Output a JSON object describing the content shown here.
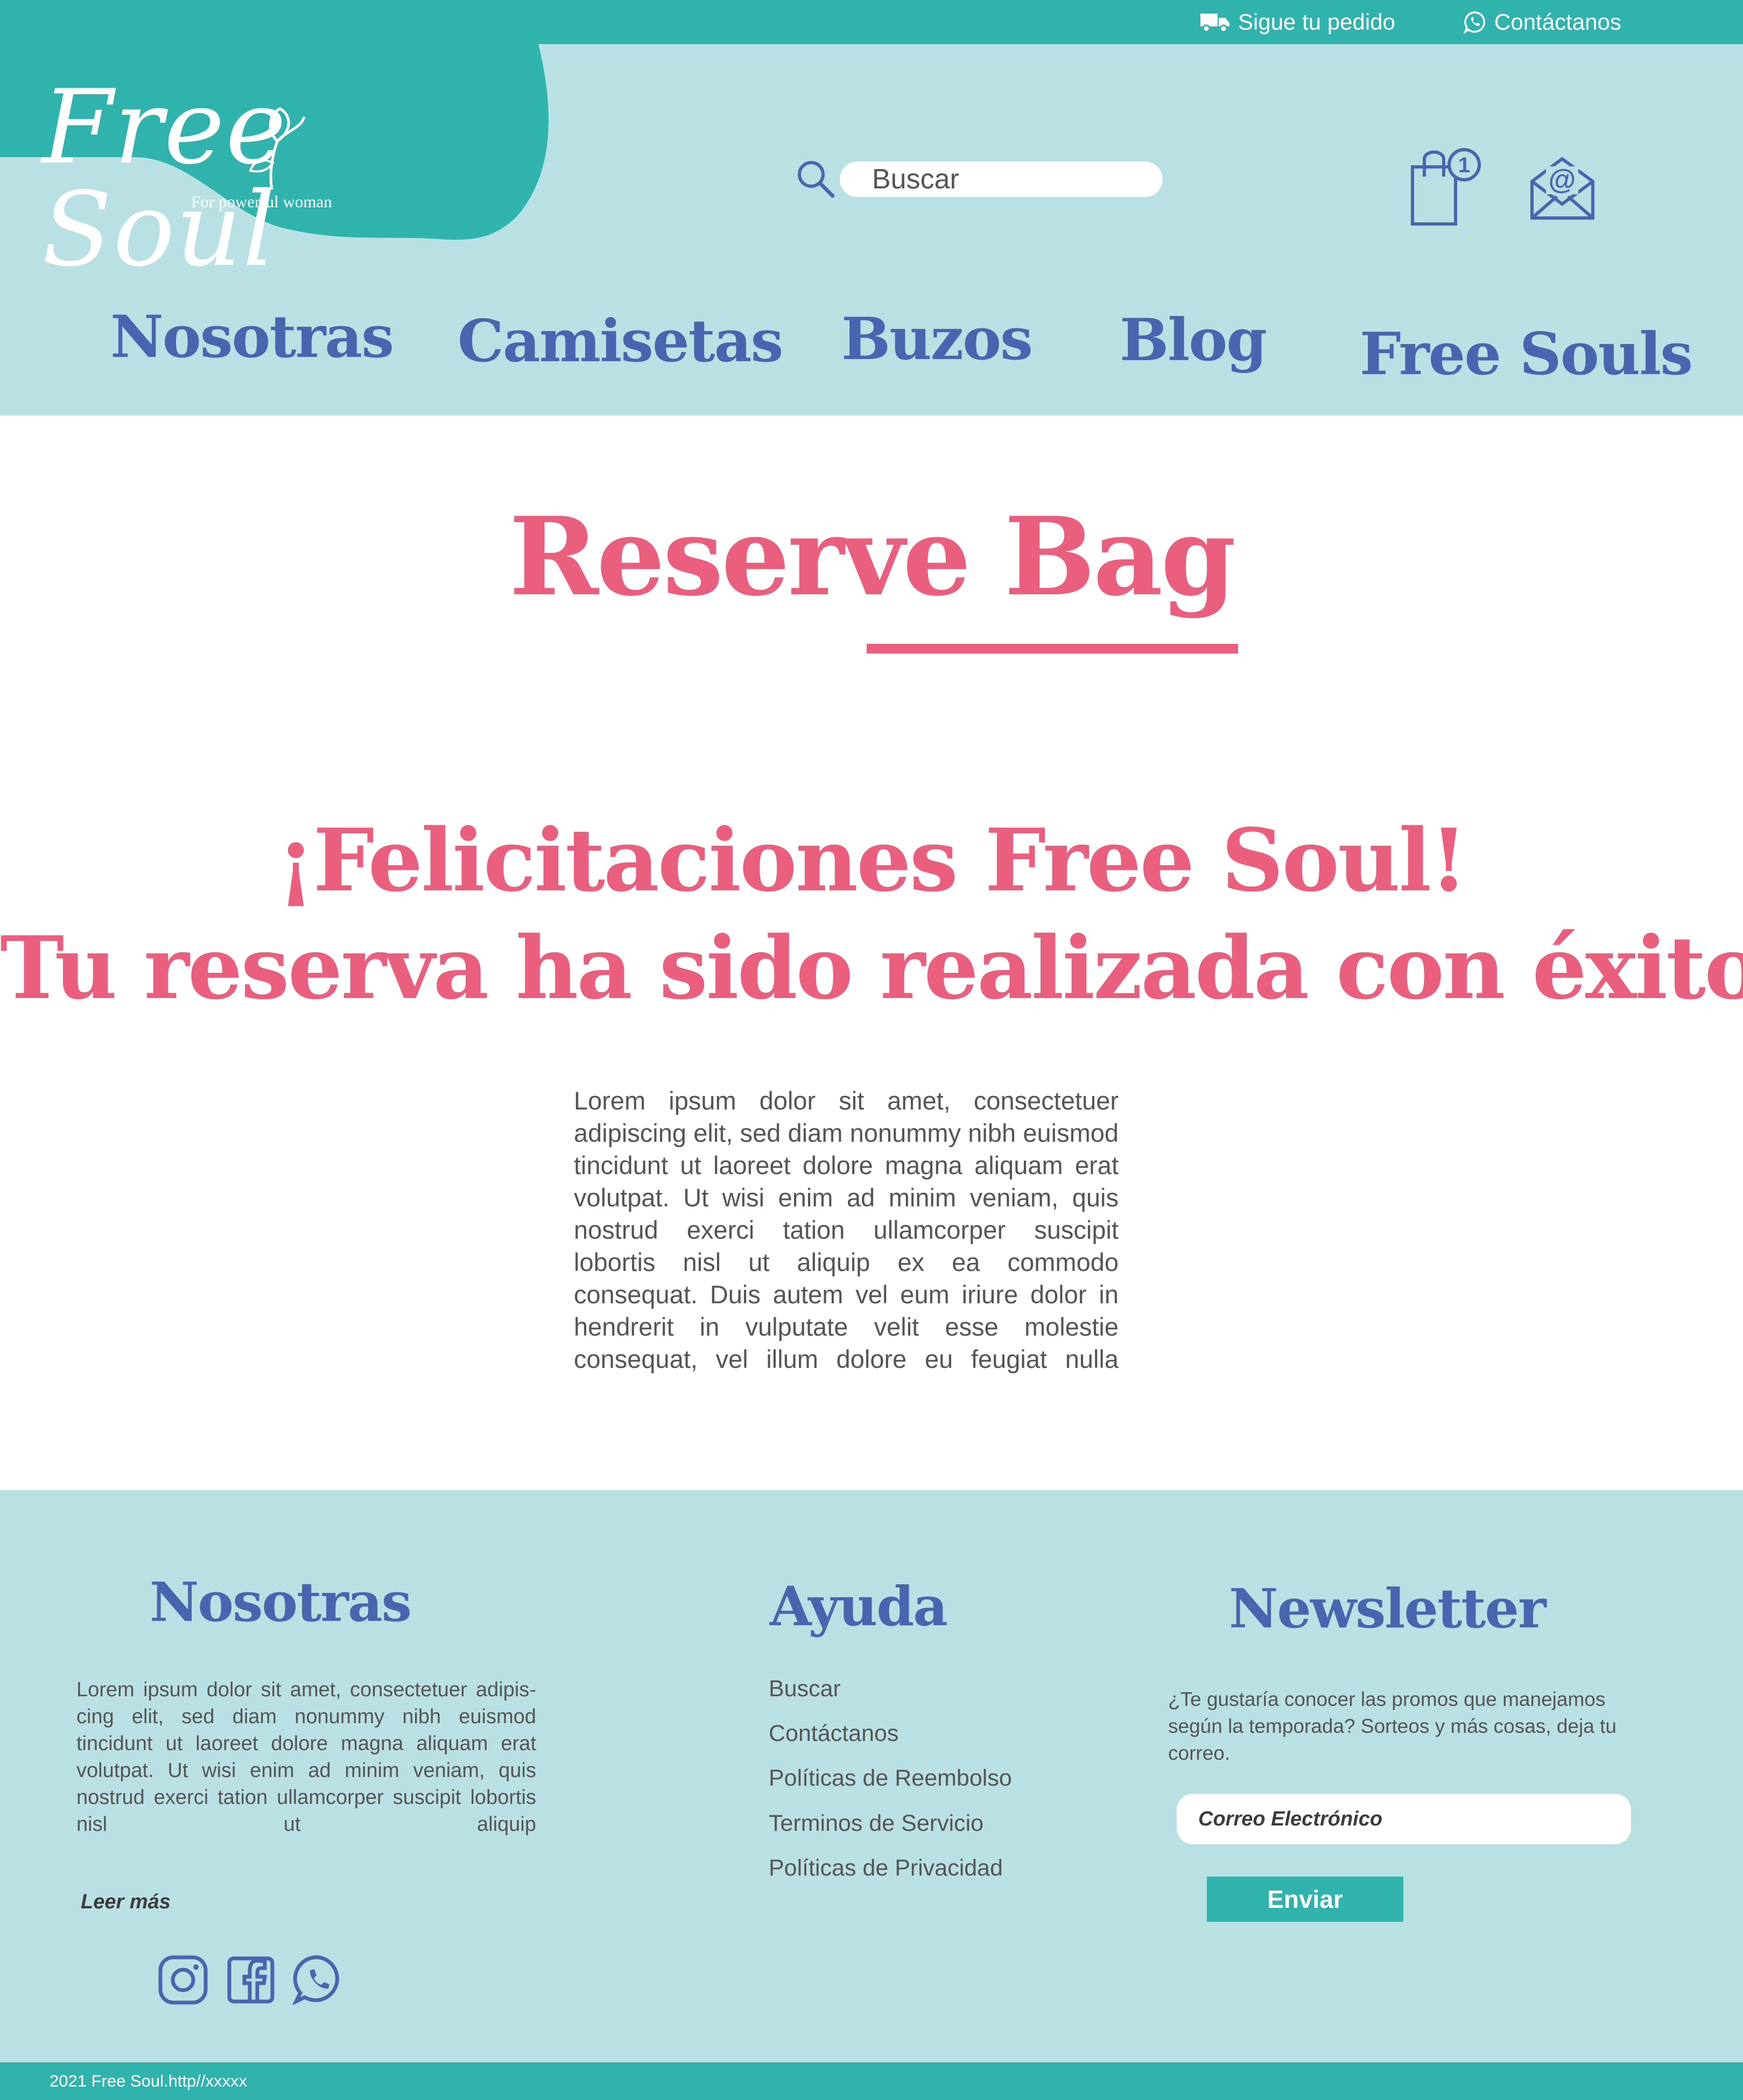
{
  "colors": {
    "teal": "#31b3ad",
    "light_teal": "#b9e0e3",
    "blue": "#4865b0",
    "pink": "#ea5f7d",
    "text_gray": "#555555"
  },
  "topbar": {
    "track_order": {
      "label": "Sigue tu pedido",
      "icon": "truck-icon"
    },
    "contact": {
      "label": "Contáctanos",
      "icon": "whatsapp-icon"
    }
  },
  "header": {
    "logo": {
      "text": "Free Soul",
      "tagline": "For powerful woman",
      "icon": "flower-icon"
    },
    "search": {
      "placeholder": "Buscar",
      "icon": "search-icon"
    },
    "cart": {
      "icon": "shopping-bag-icon",
      "badge": "1"
    },
    "mail": {
      "icon": "mail-icon"
    }
  },
  "nav": {
    "items": [
      {
        "label": "Nosotras"
      },
      {
        "label": "Camisetas"
      },
      {
        "label": "Buzos"
      },
      {
        "label": "Blog"
      },
      {
        "label": "Free Souls"
      }
    ]
  },
  "main": {
    "title": "Reserve Bag",
    "heading_line1": "¡Felicitaciones Free Soul!",
    "heading_line2": "Tu reserva ha sido realizada con éxito",
    "body": "Lorem ipsum dolor sit amet, consectetuer adipis­cing elit, sed diam nonummy nibh euismod tinci­dunt ut laoreet dolore magna aliquam erat volut­pat. Ut wisi enim ad minim veniam, quis nostrud exerci tation ullamcorper suscipit lobortis nisl ut aliquip ex ea commodo consequat. Duis autem vel eum iriure dolor in hendrerit in vulputate velit esse molestie consequat, vel illum dolore eu feugiat nulla"
  },
  "footer": {
    "about": {
      "heading": "Nosotras",
      "text": "Lorem ipsum dolor sit amet, consectetuer adipis­cing elit, sed diam nonummy nibh euismod tincidunt ut laoreet dolore magna aliquam erat volutpat. Ut wisi enim ad minim veniam, quis nostrud exerci tation ullamcorper suscipit lobor­tis nisl ut aliquip",
      "read_more": "Leer más",
      "social": [
        "instagram-icon",
        "facebook-icon",
        "whatsapp-icon"
      ]
    },
    "help": {
      "heading": "Ayuda",
      "links": [
        {
          "label": "Buscar"
        },
        {
          "label": "Contáctanos"
        },
        {
          "label": "Políticas de Reembolso"
        },
        {
          "label": "Terminos de Servicio"
        },
        {
          "label": "Políticas de Privacidad"
        }
      ]
    },
    "newsletter": {
      "heading": "Newsletter",
      "text": "¿Te gustaría conocer las promos que manejamos según la temporada? Sorteos y más cosas, deja tu correo.",
      "email_placeholder": "Correo Electrónico",
      "button": "Enviar"
    },
    "copyright": "2021 Free Soul.http//xxxxx"
  }
}
